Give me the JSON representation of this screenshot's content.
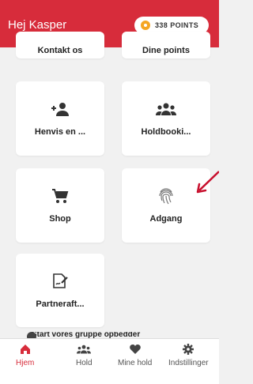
{
  "header": {
    "greeting": "Hej Kasper",
    "points_value": "338",
    "points_label": "POINTS"
  },
  "cards": {
    "contact": "Kontakt os",
    "points": "Dine points",
    "refer": "Henvis en ...",
    "booking": "Holdbooki...",
    "shop": "Shop",
    "access": "Adgang",
    "partner": "Partneraft..."
  },
  "bottom_strip_text": "Start vores gruppe opbedder",
  "tabs": [
    "Hjem",
    "Hold",
    "Mine hold",
    "Indstillinger"
  ],
  "colors": {
    "brand": "#d72c3b",
    "background": "#f1f1f1",
    "coin": "#f5a623"
  }
}
